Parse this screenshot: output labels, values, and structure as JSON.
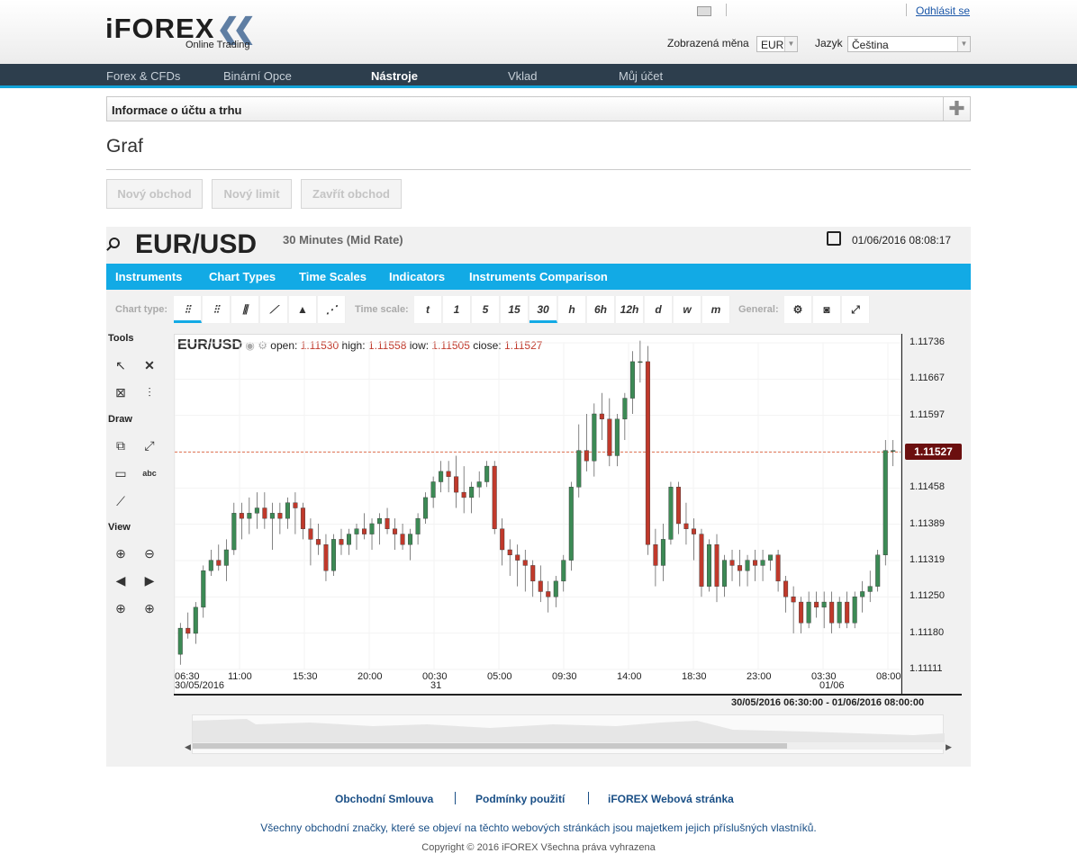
{
  "header": {
    "logo_text": "iFOREX",
    "logo_sub": "Online Trading",
    "logout": "Odhlásit se",
    "currency_label": "Zobrazená měna",
    "currency_value": "EUR",
    "language_label": "Jazyk",
    "language_value": "Čeština"
  },
  "nav": {
    "items": [
      "Forex & CFDs",
      "Binární Opce",
      "Nástroje",
      "Vklad",
      "Můj účet"
    ],
    "active_index": 2
  },
  "info_bar": {
    "title": "Informace o účtu a trhu"
  },
  "page": {
    "title": "Graf"
  },
  "actions": {
    "new_trade": "Nový obchod",
    "new_limit": "Nový limit",
    "close_trade": "Zavřít obchod"
  },
  "instrument": {
    "symbol": "EUR/USD",
    "period": "30 Minutes (Mid Rate)",
    "datetime": "01/06/2016 08:08:17"
  },
  "menu": [
    "Instruments",
    "Chart Types",
    "Time Scales",
    "Indicators",
    "Instruments Comparison"
  ],
  "toolbar": {
    "chart_type_label": "Chart type:",
    "time_scale_label": "Time scale:",
    "general_label": "General:",
    "time_scales": [
      "t",
      "1",
      "5",
      "15",
      "30",
      "h",
      "6h",
      "12h",
      "d",
      "w",
      "m"
    ],
    "selected_scale": "30"
  },
  "side_tools": {
    "tools": "Tools",
    "draw": "Draw",
    "view": "View",
    "abc": "abc"
  },
  "ohlc": {
    "symbol": "EUR/USD",
    "open_label": "open:",
    "open": "1.11530",
    "high_label": "high:",
    "high": "1.11558",
    "low_label": "low:",
    "low": "1.11505",
    "close_label": "close:",
    "close": "1.11527"
  },
  "current_price": "1.11527",
  "range_text": "30/05/2016 06:30:00 - 01/06/2016 08:00:00",
  "chart_data": {
    "type": "candlestick",
    "y_ticks": [
      "1.11736",
      "1.11667",
      "1.11597",
      "1.11528",
      "1.11458",
      "1.11389",
      "1.11319",
      "1.11250",
      "1.11180",
      "1.11111"
    ],
    "ylim": [
      1.11111,
      1.11736
    ],
    "x_ticks": [
      {
        "label": "06:30",
        "sub": "30/05/2016"
      },
      {
        "label": "11:00",
        "sub": ""
      },
      {
        "label": "15:30",
        "sub": ""
      },
      {
        "label": "20:00",
        "sub": ""
      },
      {
        "label": "00:30",
        "sub": "31"
      },
      {
        "label": "05:00",
        "sub": ""
      },
      {
        "label": "09:30",
        "sub": ""
      },
      {
        "label": "14:00",
        "sub": ""
      },
      {
        "label": "18:30",
        "sub": ""
      },
      {
        "label": "23:00",
        "sub": ""
      },
      {
        "label": "03:30",
        "sub": "01/06"
      },
      {
        "label": "08:00",
        "sub": ""
      }
    ],
    "candles": [
      [
        1.1114,
        1.112,
        1.1112,
        1.1119
      ],
      [
        1.1119,
        1.1122,
        1.1117,
        1.1118
      ],
      [
        1.1118,
        1.1124,
        1.1116,
        1.1123
      ],
      [
        1.1123,
        1.1131,
        1.1121,
        1.113
      ],
      [
        1.113,
        1.1134,
        1.1129,
        1.1132
      ],
      [
        1.1132,
        1.1135,
        1.113,
        1.1131
      ],
      [
        1.1131,
        1.1136,
        1.1128,
        1.1134
      ],
      [
        1.1134,
        1.1143,
        1.1133,
        1.1141
      ],
      [
        1.1141,
        1.1143,
        1.1136,
        1.114
      ],
      [
        1.114,
        1.1144,
        1.1137,
        1.1141
      ],
      [
        1.1141,
        1.1145,
        1.1138,
        1.1142
      ],
      [
        1.1142,
        1.1145,
        1.1138,
        1.114
      ],
      [
        1.114,
        1.1143,
        1.1134,
        1.1141
      ],
      [
        1.1141,
        1.1143,
        1.1137,
        1.114
      ],
      [
        1.114,
        1.1144,
        1.1138,
        1.1143
      ],
      [
        1.1143,
        1.1145,
        1.1137,
        1.1142
      ],
      [
        1.1142,
        1.1143,
        1.1136,
        1.1138
      ],
      [
        1.1138,
        1.114,
        1.1131,
        1.1136
      ],
      [
        1.1136,
        1.1139,
        1.1133,
        1.1135
      ],
      [
        1.1135,
        1.1137,
        1.1128,
        1.113
      ],
      [
        1.113,
        1.1137,
        1.1129,
        1.1136
      ],
      [
        1.1136,
        1.1138,
        1.1133,
        1.1135
      ],
      [
        1.1135,
        1.1138,
        1.1133,
        1.1137
      ],
      [
        1.1137,
        1.1139,
        1.1134,
        1.1138
      ],
      [
        1.1138,
        1.1141,
        1.1136,
        1.1137
      ],
      [
        1.1137,
        1.114,
        1.1134,
        1.1139
      ],
      [
        1.1139,
        1.1141,
        1.1135,
        1.114
      ],
      [
        1.114,
        1.1142,
        1.1137,
        1.1138
      ],
      [
        1.1138,
        1.114,
        1.1134,
        1.1137
      ],
      [
        1.1137,
        1.1139,
        1.1134,
        1.1135
      ],
      [
        1.1135,
        1.1138,
        1.1132,
        1.1137
      ],
      [
        1.1137,
        1.1141,
        1.1135,
        1.114
      ],
      [
        1.114,
        1.1145,
        1.1139,
        1.1144
      ],
      [
        1.1144,
        1.1148,
        1.1142,
        1.1147
      ],
      [
        1.1147,
        1.1151,
        1.1145,
        1.1149
      ],
      [
        1.1149,
        1.1151,
        1.1145,
        1.1148
      ],
      [
        1.1148,
        1.1152,
        1.1142,
        1.1145
      ],
      [
        1.1145,
        1.115,
        1.1141,
        1.1144
      ],
      [
        1.1144,
        1.1147,
        1.1141,
        1.1146
      ],
      [
        1.1146,
        1.1149,
        1.1144,
        1.1147
      ],
      [
        1.1147,
        1.1151,
        1.1146,
        1.115
      ],
      [
        1.115,
        1.1151,
        1.1137,
        1.1138
      ],
      [
        1.1138,
        1.114,
        1.1131,
        1.1134
      ],
      [
        1.1134,
        1.1136,
        1.1129,
        1.1133
      ],
      [
        1.1133,
        1.1135,
        1.1127,
        1.1132
      ],
      [
        1.1132,
        1.1134,
        1.1126,
        1.1131
      ],
      [
        1.1131,
        1.1132,
        1.1125,
        1.1128
      ],
      [
        1.1128,
        1.1131,
        1.1124,
        1.1126
      ],
      [
        1.1126,
        1.1128,
        1.1122,
        1.1125
      ],
      [
        1.1125,
        1.1129,
        1.1123,
        1.1128
      ],
      [
        1.1128,
        1.1133,
        1.1126,
        1.1132
      ],
      [
        1.1132,
        1.1147,
        1.113,
        1.1146
      ],
      [
        1.1146,
        1.1158,
        1.1144,
        1.1153
      ],
      [
        1.1153,
        1.116,
        1.1149,
        1.1151
      ],
      [
        1.1151,
        1.1162,
        1.1148,
        1.116
      ],
      [
        1.116,
        1.1164,
        1.1155,
        1.1159
      ],
      [
        1.1159,
        1.1163,
        1.115,
        1.1152
      ],
      [
        1.1152,
        1.116,
        1.115,
        1.1159
      ],
      [
        1.1159,
        1.1164,
        1.1155,
        1.1163
      ],
      [
        1.1163,
        1.1172,
        1.116,
        1.117
      ],
      [
        1.117,
        1.1174,
        1.1166,
        1.117
      ],
      [
        1.117,
        1.1173,
        1.1133,
        1.1135
      ],
      [
        1.1135,
        1.1138,
        1.1127,
        1.1131
      ],
      [
        1.1131,
        1.1139,
        1.1128,
        1.1136
      ],
      [
        1.1136,
        1.1147,
        1.1135,
        1.1146
      ],
      [
        1.1146,
        1.1147,
        1.1137,
        1.1139
      ],
      [
        1.1139,
        1.1143,
        1.1135,
        1.1138
      ],
      [
        1.1138,
        1.114,
        1.1132,
        1.1137
      ],
      [
        1.1137,
        1.1138,
        1.1125,
        1.1127
      ],
      [
        1.1127,
        1.1136,
        1.1126,
        1.1135
      ],
      [
        1.1135,
        1.1137,
        1.1124,
        1.1127
      ],
      [
        1.1127,
        1.1133,
        1.1125,
        1.1132
      ],
      [
        1.1132,
        1.1134,
        1.1128,
        1.1131
      ],
      [
        1.1131,
        1.1134,
        1.1127,
        1.113
      ],
      [
        1.113,
        1.1133,
        1.1127,
        1.1132
      ],
      [
        1.1132,
        1.1134,
        1.1128,
        1.1131
      ],
      [
        1.1131,
        1.1134,
        1.1128,
        1.1132
      ],
      [
        1.1132,
        1.1133,
        1.113,
        1.1133
      ],
      [
        1.1133,
        1.1134,
        1.1126,
        1.1128
      ],
      [
        1.1128,
        1.1129,
        1.1122,
        1.1125
      ],
      [
        1.1125,
        1.1127,
        1.1118,
        1.1124
      ],
      [
        1.1124,
        1.1125,
        1.1118,
        1.112
      ],
      [
        1.112,
        1.1126,
        1.1119,
        1.1124
      ],
      [
        1.1124,
        1.1126,
        1.1121,
        1.1123
      ],
      [
        1.1123,
        1.1126,
        1.1119,
        1.1124
      ],
      [
        1.1124,
        1.1126,
        1.1118,
        1.112
      ],
      [
        1.112,
        1.1125,
        1.1119,
        1.1124
      ],
      [
        1.1124,
        1.1126,
        1.1119,
        1.112
      ],
      [
        1.112,
        1.1126,
        1.1119,
        1.1125
      ],
      [
        1.1125,
        1.1128,
        1.1122,
        1.1126
      ],
      [
        1.1126,
        1.113,
        1.1124,
        1.1127
      ],
      [
        1.1127,
        1.1134,
        1.1126,
        1.1133
      ],
      [
        1.1133,
        1.1155,
        1.1131,
        1.1153
      ],
      [
        1.1153,
        1.1155,
        1.115,
        1.1153
      ]
    ]
  },
  "footer": {
    "links": [
      "Obchodní Smlouva",
      "Podmínky použití",
      "iFOREX Webová stránka"
    ],
    "notice": "Všechny obchodní značky, které se objeví na těchto webových stránkách jsou majetkem jejich příslušných vlastníků.",
    "copyright": "Copyright © 2016 iFOREX Všechna práva vyhrazena"
  },
  "colors": {
    "nav_bg": "#2d3e4d",
    "accent": "#12aae5",
    "up": "#3c8a55",
    "down": "#c0392b",
    "price_tag": "#6b0f0f"
  }
}
